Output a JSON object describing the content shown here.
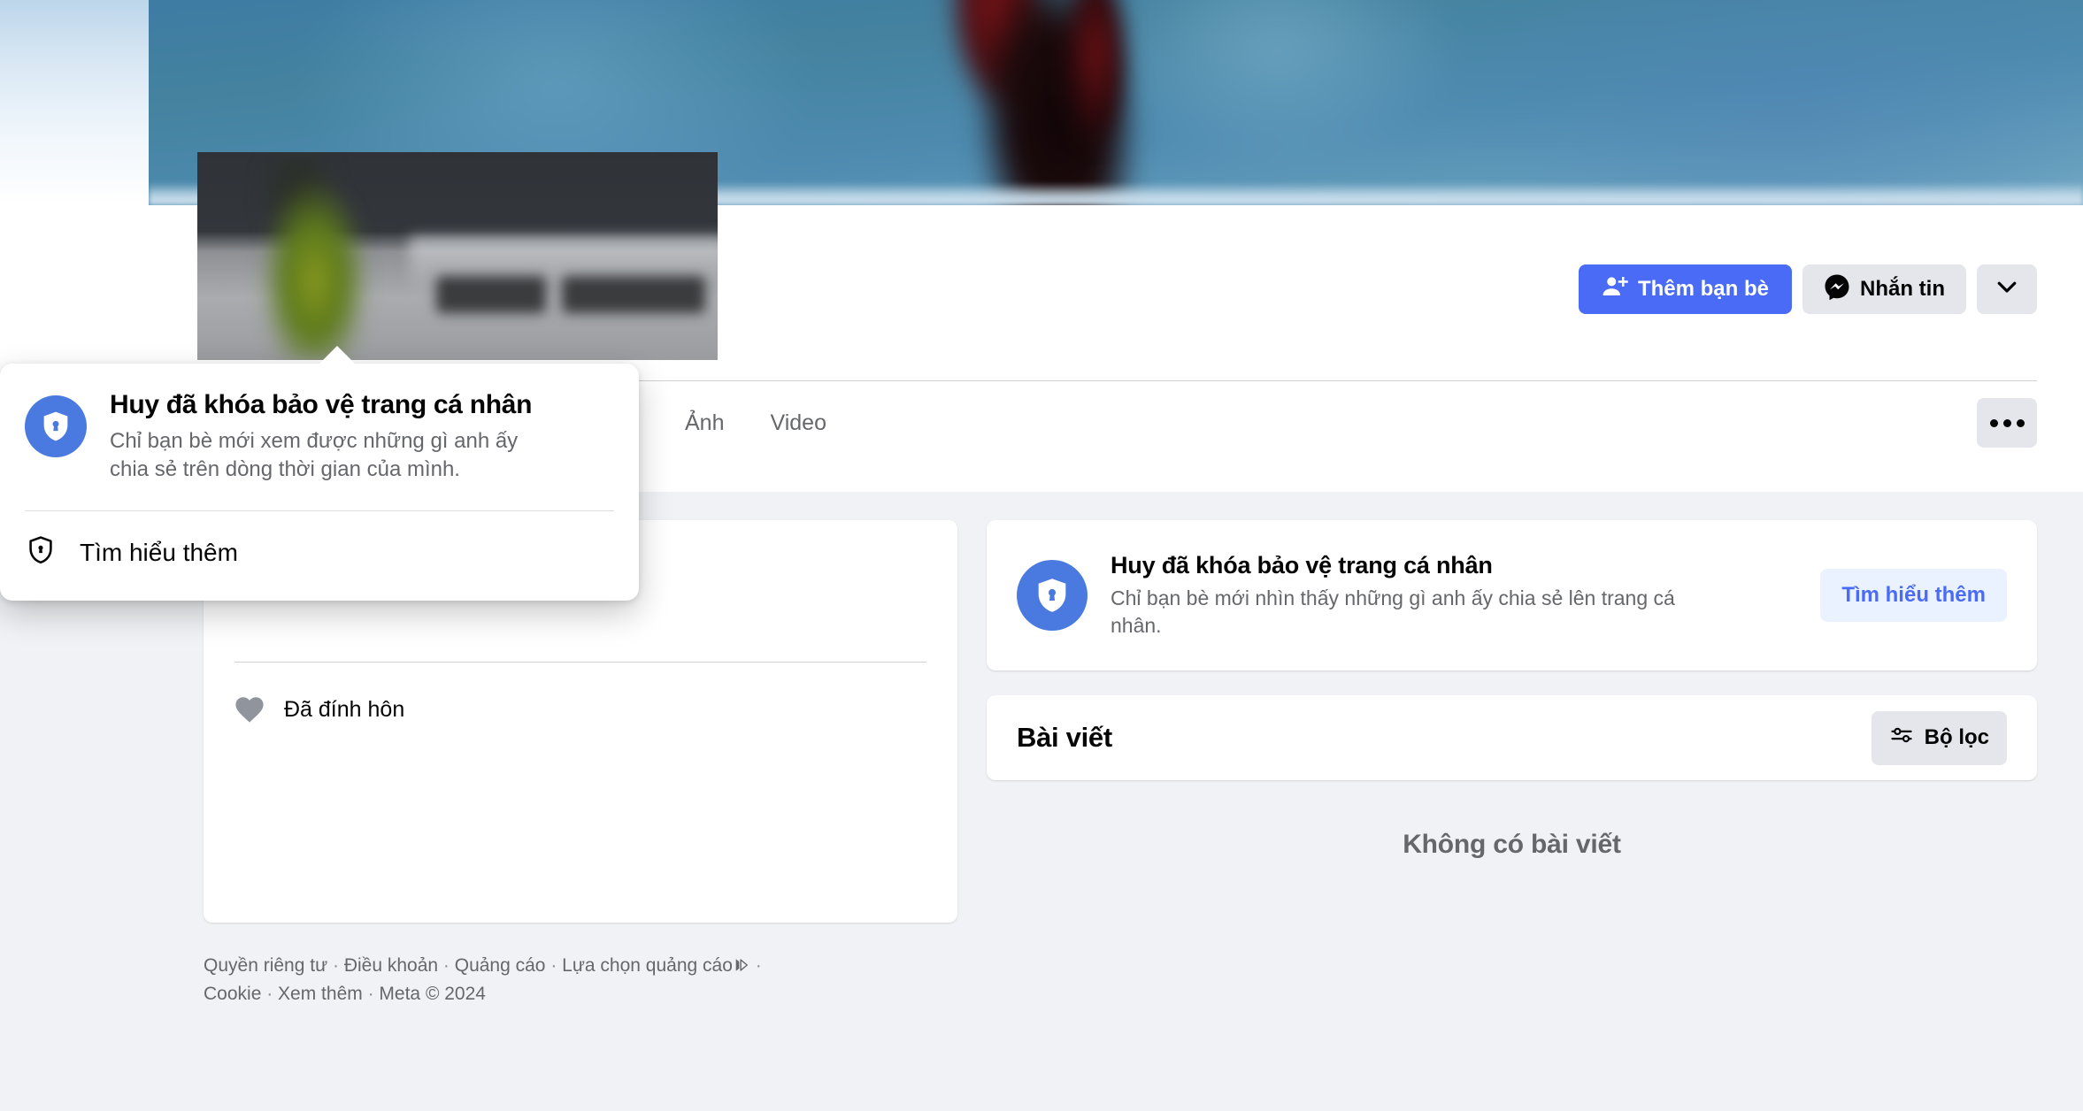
{
  "header": {
    "actions": {
      "add_friend_label": "Thêm bạn bè",
      "message_label": "Nhắn tin",
      "more_label": ""
    },
    "tabs": [
      {
        "label": "Ảnh"
      },
      {
        "label": "Video"
      }
    ],
    "more_tab_label": ""
  },
  "left_card": {
    "relationship_status": "Đã đính hôn"
  },
  "lock_card": {
    "title": "Huy đã khóa bảo vệ trang cá nhân",
    "subtitle": "Chỉ bạn bè mới nhìn thấy những gì anh ấy chia sẻ lên trang cá nhân.",
    "learn_more_label": "Tìm hiểu thêm"
  },
  "posts": {
    "title": "Bài viết",
    "filter_label": "Bộ lọc",
    "empty_label": "Không có bài viết"
  },
  "popup": {
    "title": "Huy đã khóa bảo vệ trang cá nhân",
    "subtitle": "Chỉ bạn bè mới xem được những gì anh ấy chia sẻ trên dòng thời gian của mình.",
    "action_label": "Tìm hiểu thêm"
  },
  "footer": {
    "links": [
      "Quyền riêng tư",
      "Điều khoản",
      "Quảng cáo",
      "Lựa chọn quảng cáo",
      "Cookie",
      "Xem thêm"
    ],
    "copyright": "Meta © 2024"
  },
  "colors": {
    "accent_blue": "#4a6bf5",
    "shield_blue": "#4a7ae0",
    "page_bg": "#f0f2f5",
    "card_bg": "#ffffff",
    "text_primary": "#050505",
    "text_secondary": "#65676b",
    "chip_gray": "#e4e6eb",
    "learn_more_bg": "#ebf2ff"
  }
}
